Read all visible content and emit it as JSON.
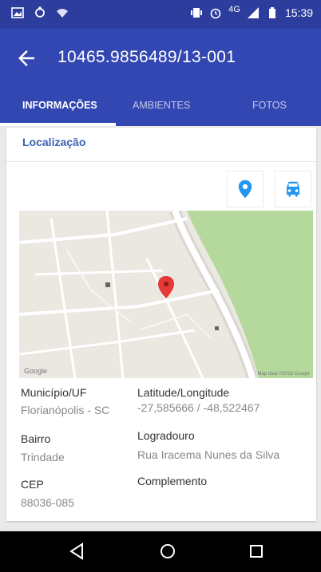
{
  "status_bar": {
    "network": "4G",
    "time": "15:39"
  },
  "app_bar": {
    "title": "10465.9856489/13-001",
    "back_icon": "arrow-left-icon"
  },
  "tabs": [
    {
      "label": "INFORMAÇÕES",
      "active": true
    },
    {
      "label": "AMBIENTES",
      "active": false
    },
    {
      "label": "FOTOS",
      "active": false
    }
  ],
  "card": {
    "header": "Localização",
    "location_icon": "map-marker-icon",
    "car_icon": "car-icon",
    "map": {
      "google_label": "Google",
      "attribution": "Map data ©2016 Google",
      "accent_water": "#a8d59a"
    },
    "fields": {
      "municipio_label": "Município/UF",
      "municipio_value": "Florianópolis - SC",
      "latlng_label": "Latitude/Longitude",
      "latlng_value": "-27,585666 / -48,522467",
      "bairro_label": "Bairro",
      "bairro_value": "Trindade",
      "logradouro_label": "Logradouro",
      "logradouro_value": "Rua Iracema Nunes da Silva",
      "cep_label": "CEP",
      "cep_value": "88036-085",
      "complemento_label": "Complemento"
    }
  },
  "colors": {
    "primary": "#3347b2",
    "primary_dark": "#2c3d9e",
    "accent": "#2196f3"
  }
}
